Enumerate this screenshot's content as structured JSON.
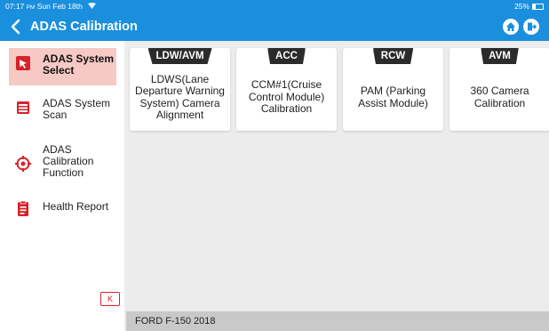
{
  "status": {
    "time": "07:17",
    "ampm": "PM",
    "date": "Sun Feb 18th",
    "battery": "25%",
    "battery_level": 0.25
  },
  "header": {
    "title": "ADAS Calibration"
  },
  "sidebar": {
    "items": [
      {
        "label": "ADAS System Select",
        "icon": "arrow-select-icon"
      },
      {
        "label": "ADAS System Scan",
        "icon": "scan-icon"
      },
      {
        "label": "ADAS Calibration Function",
        "icon": "target-icon"
      },
      {
        "label": "Health Report",
        "icon": "report-icon"
      }
    ],
    "collapse_label": "K"
  },
  "cards": [
    {
      "badge": "LDW/AVM",
      "text": "LDWS(Lane Departure Warning System) Camera Alignment"
    },
    {
      "badge": "ACC",
      "text": "CCM#1(Cruise Control Module) Calibration"
    },
    {
      "badge": "RCW",
      "text": "PAM (Parking Assist Module)"
    },
    {
      "badge": "AVM",
      "text": "360 Camera Calibration"
    }
  ],
  "footer": {
    "vehicle": "FORD F-150 2018"
  },
  "colors": {
    "accent": "#1a8fde",
    "active_bg": "#f6c9c5",
    "icon_red": "#d7222a",
    "badge_bg": "#2b2b2b"
  }
}
